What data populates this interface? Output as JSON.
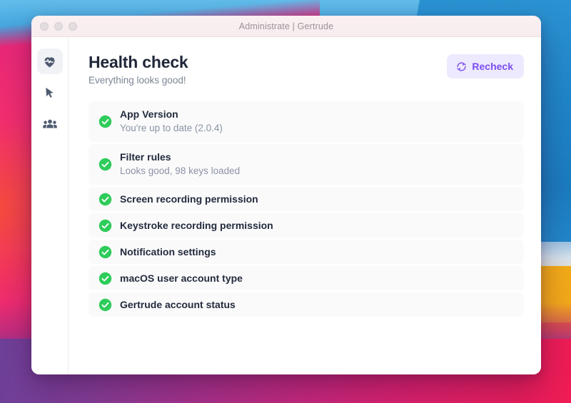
{
  "window": {
    "title": "Administrate | Gertrude",
    "traffic_lights": [
      "close",
      "minimize",
      "zoom"
    ]
  },
  "sidebar": {
    "items": [
      {
        "name": "health-check",
        "icon": "heart-pulse-icon",
        "active": true
      },
      {
        "name": "activity",
        "icon": "cursor-pointer-icon",
        "active": false
      },
      {
        "name": "users",
        "icon": "users-group-icon",
        "active": false
      }
    ]
  },
  "header": {
    "title": "Health check",
    "subtitle": "Everything looks good!",
    "recheck_label": "Recheck",
    "recheck_icon": "refresh-icon",
    "accent_color": "#7c4ef0",
    "accent_bg": "#ede9fe"
  },
  "checks": {
    "status_color": "#2ecc5a",
    "items": [
      {
        "label": "App Version",
        "detail": "You're up to date (2.0.4)",
        "status": "ok",
        "icon": "check-circle-icon"
      },
      {
        "label": "Filter rules",
        "detail": "Looks good, 98 keys loaded",
        "status": "ok",
        "icon": "check-circle-icon"
      },
      {
        "label": "Screen recording permission",
        "detail": "",
        "status": "ok",
        "icon": "check-circle-icon"
      },
      {
        "label": "Keystroke recording permission",
        "detail": "",
        "status": "ok",
        "icon": "check-circle-icon"
      },
      {
        "label": "Notification settings",
        "detail": "",
        "status": "ok",
        "icon": "check-circle-icon"
      },
      {
        "label": "macOS user account type",
        "detail": "",
        "status": "ok",
        "icon": "check-circle-icon"
      },
      {
        "label": "Gertrude account status",
        "detail": "",
        "status": "ok",
        "icon": "check-circle-icon"
      }
    ]
  }
}
